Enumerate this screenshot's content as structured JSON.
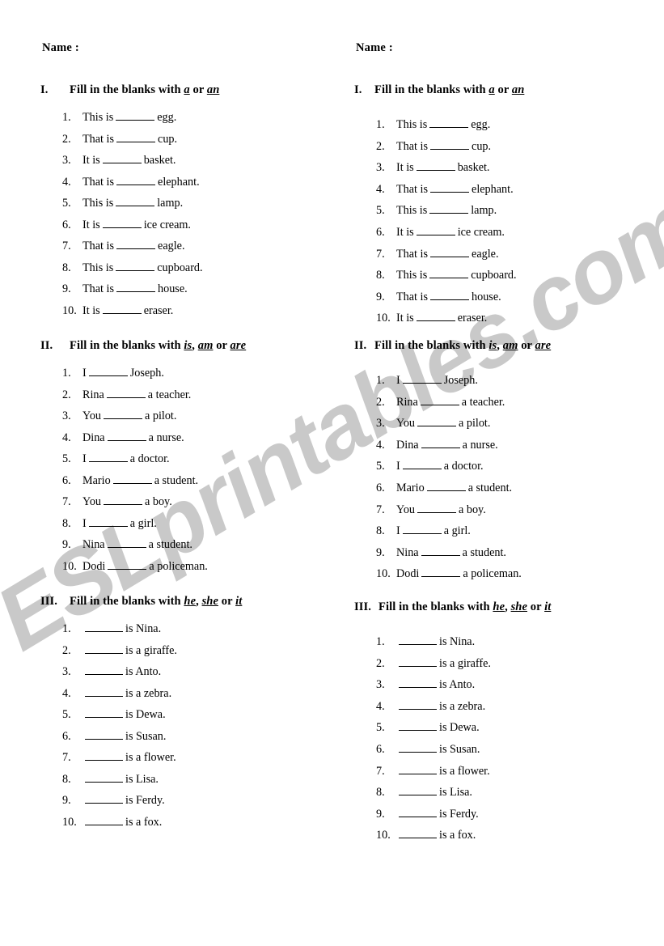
{
  "page": {
    "watermark_text": "ESLprintables.com",
    "watermark_color": "#c9c9c9",
    "background_color": "#ffffff",
    "text_color": "#000000"
  },
  "name_label": "Name :",
  "sections": [
    {
      "numeral": "I.",
      "title_prefix": "Fill in the blanks with ",
      "choice_a": "a",
      "joiner": " or ",
      "choice_b": "an",
      "choice_c": "",
      "items": [
        {
          "num": "1.",
          "before": "This is",
          "after": "egg."
        },
        {
          "num": "2.",
          "before": "That is",
          "after": "cup."
        },
        {
          "num": "3.",
          "before": "It is",
          "after": "basket."
        },
        {
          "num": "4.",
          "before": "That is",
          "after": "elephant."
        },
        {
          "num": "5.",
          "before": "This is",
          "after": "lamp."
        },
        {
          "num": "6.",
          "before": "It is",
          "after": "ice cream."
        },
        {
          "num": "7.",
          "before": "That is",
          "after": "eagle."
        },
        {
          "num": "8.",
          "before": "This is",
          "after": "cupboard."
        },
        {
          "num": "9.",
          "before": "That is",
          "after": "house."
        },
        {
          "num": "10.",
          "before": "It is",
          "after": "eraser."
        }
      ]
    },
    {
      "numeral": "II.",
      "title_prefix": "Fill in the blanks with ",
      "choice_a": "is",
      "joiner": ", ",
      "choice_b": "am",
      "joiner2": " or ",
      "choice_c": "are",
      "items": [
        {
          "num": "1.",
          "before": "I",
          "after": "Joseph."
        },
        {
          "num": "2.",
          "before": "Rina",
          "after": "a teacher."
        },
        {
          "num": "3.",
          "before": "You",
          "after": "a pilot."
        },
        {
          "num": "4.",
          "before": "Dina",
          "after": "a nurse."
        },
        {
          "num": "5.",
          "before": "I",
          "after": "a doctor."
        },
        {
          "num": "6.",
          "before": "Mario",
          "after": "a student."
        },
        {
          "num": "7.",
          "before": "You",
          "after": "a boy."
        },
        {
          "num": "8.",
          "before": "I",
          "after": "a girl."
        },
        {
          "num": "9.",
          "before": "Nina",
          "after": "a student."
        },
        {
          "num": "10.",
          "before": "Dodi",
          "after": "a policeman."
        }
      ]
    },
    {
      "numeral": "III.",
      "title_prefix": "Fill in the blanks with ",
      "choice_a": "he",
      "joiner": ", ",
      "choice_b": "she",
      "joiner2": " or ",
      "choice_c": "it",
      "items": [
        {
          "num": "1.",
          "before": "",
          "after": "is Nina."
        },
        {
          "num": "2.",
          "before": "",
          "after": "is a giraffe."
        },
        {
          "num": "3.",
          "before": "",
          "after": "is Anto."
        },
        {
          "num": "4.",
          "before": "",
          "after": "is a zebra."
        },
        {
          "num": "5.",
          "before": "",
          "after": "is Dewa."
        },
        {
          "num": "6.",
          "before": "",
          "after": "is Susan."
        },
        {
          "num": "7.",
          "before": "",
          "after": "is a flower."
        },
        {
          "num": "8.",
          "before": "",
          "after": "is Lisa."
        },
        {
          "num": "9.",
          "before": "",
          "after": "is Ferdy."
        },
        {
          "num": "10.",
          "before": "",
          "after": "is a fox."
        }
      ]
    }
  ]
}
